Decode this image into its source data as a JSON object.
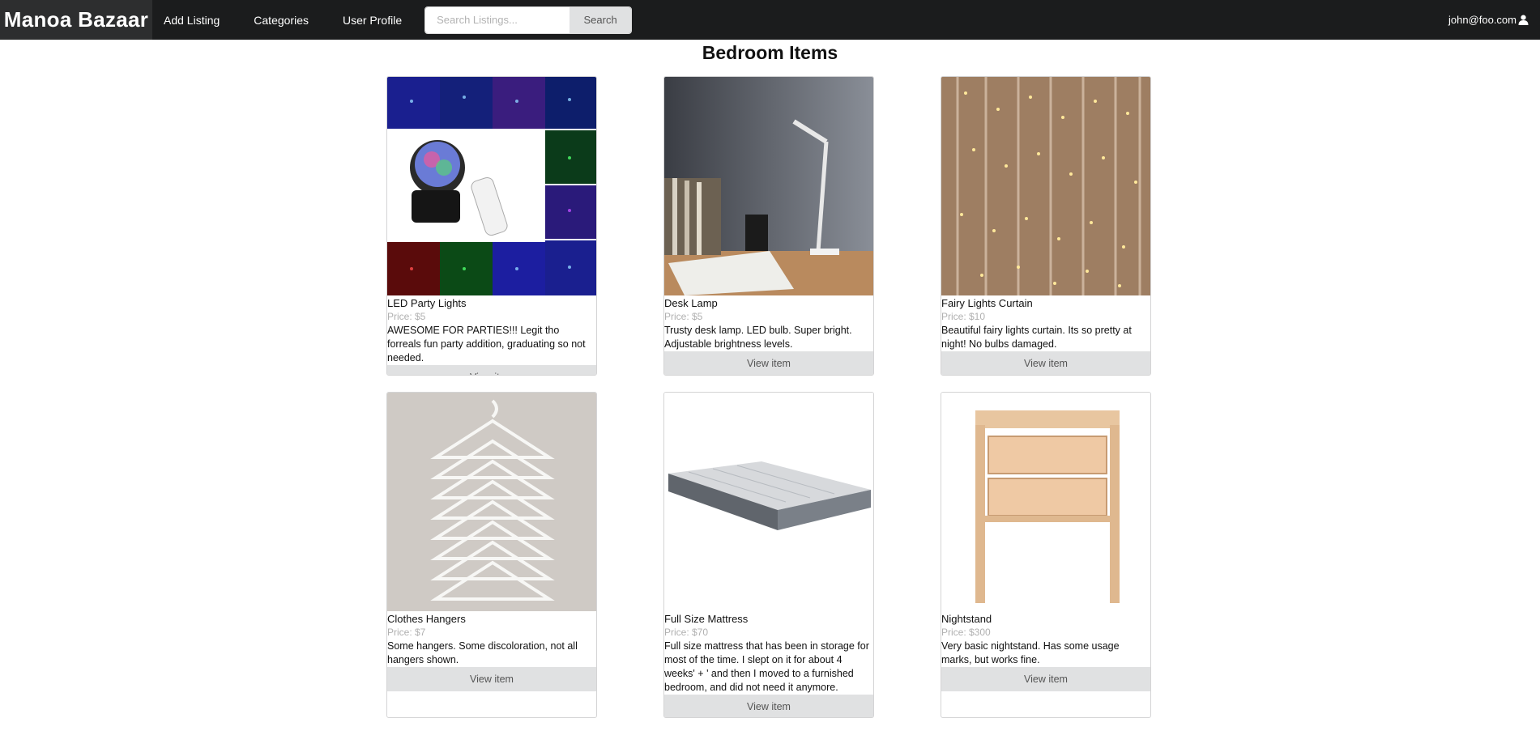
{
  "nav": {
    "brand": "Manoa Bazaar",
    "links": [
      "Add Listing",
      "Categories",
      "User Profile"
    ],
    "search_placeholder": "Search Listings...",
    "search_button": "Search",
    "user": "john@foo.com"
  },
  "page_title": "Bedroom Items",
  "items": [
    {
      "name": "LED Party Lights",
      "price": "Price: $5",
      "description": "AWESOME FOR PARTIES!!! Legit tho forreals fun party addition, graduating so not needed.",
      "button": "View item"
    },
    {
      "name": "Desk Lamp",
      "price": "Price: $5",
      "description": "Trusty desk lamp. LED bulb. Super bright. Adjustable brightness levels.",
      "button": "View item"
    },
    {
      "name": "Fairy Lights Curtain",
      "price": "Price: $10",
      "description": "Beautiful fairy lights curtain. Its so pretty at night! No bulbs damaged.",
      "button": "View item"
    },
    {
      "name": "Clothes Hangers",
      "price": "Price: $7",
      "description": "Some hangers. Some discoloration, not all hangers shown.",
      "button": "View item"
    },
    {
      "name": "Full Size Mattress",
      "price": "Price: $70",
      "description": "Full size mattress that has been in storage for most of the time. I slept on it for about 4 weeks' + ' and then I moved to a furnished bedroom, and did not need it anymore.",
      "button": "View item"
    },
    {
      "name": "Nightstand",
      "price": "Price: $300",
      "description": "Very basic nightstand. Has some usage marks, but works fine.",
      "button": "View item"
    }
  ],
  "colors": {
    "navbar": "#1b1c1d",
    "brand_bg": "#2d2e2f",
    "button_bg": "#e0e1e2",
    "price_text": "#b0b0b0"
  }
}
